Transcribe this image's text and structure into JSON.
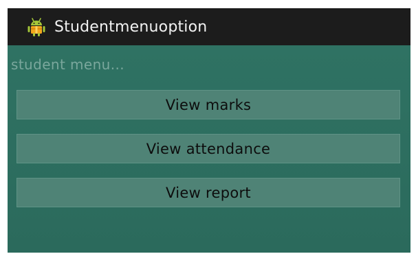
{
  "titlebar": {
    "app_icon": "android-icon",
    "title": "Studentmenuoption"
  },
  "main": {
    "subtitle": "student menu...",
    "buttons": [
      {
        "label": "View marks"
      },
      {
        "label": "View attendance"
      },
      {
        "label": "View report"
      }
    ]
  },
  "colors": {
    "titlebar_bg": "#1c1c1c",
    "content_bg": "#2d6f60",
    "button_bg": "#4f8376",
    "android_green": "#a4c639",
    "icon_orange": "#f2a51c"
  }
}
